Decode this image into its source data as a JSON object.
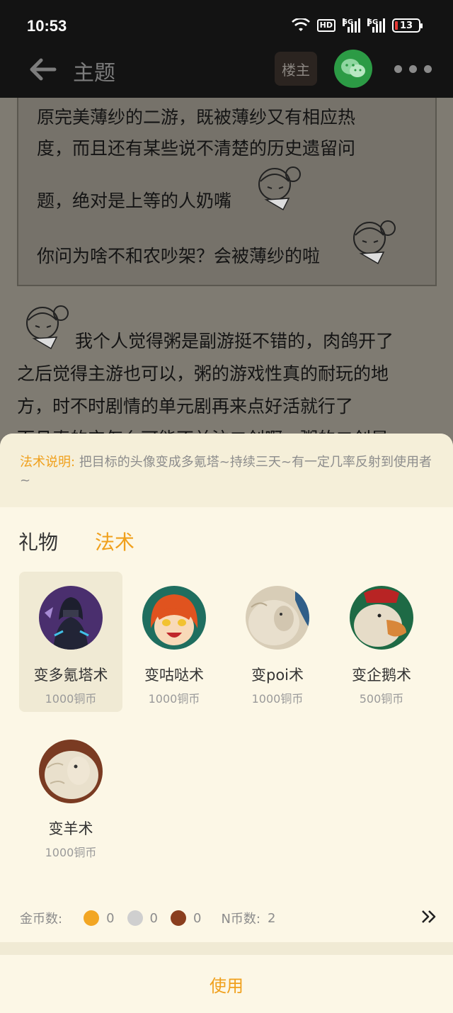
{
  "status": {
    "time": "10:53",
    "battery": "13",
    "hd": "HD",
    "net1": "5G",
    "net2": "5G"
  },
  "header": {
    "title": "主题",
    "louzhu": "楼主"
  },
  "post": {
    "quote_lines": [
      "原完美薄纱的二游，既被薄纱又有相应热",
      "度，而且还有某些说不清楚的历史遗留问",
      "题，绝对是上等的人奶嘴",
      "你问为啥不和农吵架？会被薄纱的啦"
    ],
    "body_lines": [
      "我个人觉得粥是副游挺不错的，肉鸽开了",
      "之后觉得主游也可以，粥的游戏性真的耐玩的地",
      "方，时不时剧情的单元剧再来点好活就行了",
      "而且真的它怎么可能不关注二创啊，粥的二创是"
    ]
  },
  "panel": {
    "desc_label": "法术说明:",
    "desc_text": "把目标的头像变成多氪塔~持续三天~有一定几率反射到使用者~",
    "tabs": [
      "礼物",
      "法术"
    ],
    "items": [
      {
        "name": "变多氪塔术",
        "price": "1000铜币"
      },
      {
        "name": "变咕哒术",
        "price": "1000铜币"
      },
      {
        "name": "变poi术",
        "price": "1000铜币"
      },
      {
        "name": "变企鹅术",
        "price": "500铜币"
      },
      {
        "name": "变羊术",
        "price": "1000铜币"
      }
    ],
    "coins_label": "金币数:",
    "gold_count": "0",
    "silver_count": "0",
    "copper_count": "0",
    "n_label": "N币数:",
    "n_count": "2",
    "use_label": "使用"
  },
  "colors": {
    "accent": "#f0a01c",
    "panel_bg": "#fcf7e6",
    "wechat": "#2c9b45"
  }
}
